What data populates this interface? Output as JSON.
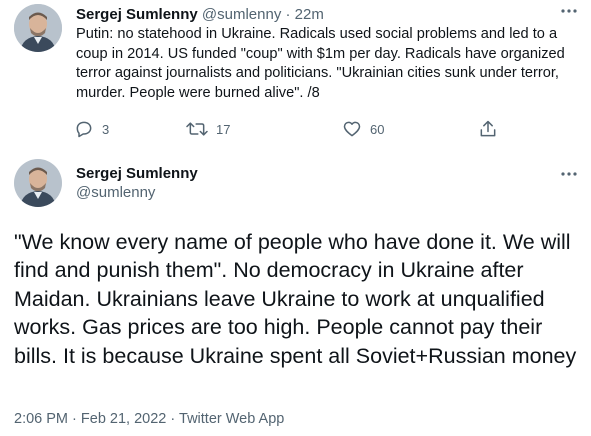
{
  "tweet1": {
    "author_name": "Sergej Sumlenny",
    "author_handle": "@sumlenny",
    "separator": "·",
    "time": "22m",
    "text": "Putin: no statehood in Ukraine. Radicals used social problems and led to a coup in 2014. US funded \"coup\" with $1m per day. Radicals have organized terror against journalists and politicians. \"Ukrainian cities sunk under terror, murder. People were burned alive\". /8",
    "replies": "3",
    "retweets": "17",
    "likes": "60",
    "icons": {
      "reply": "reply-icon",
      "retweet": "retweet-icon",
      "like": "heart-icon",
      "share": "share-icon",
      "more": "more-icon"
    }
  },
  "tweet2": {
    "author_name": "Sergej Sumlenny",
    "author_handle": "@sumlenny",
    "text": "\"We know every name of people who have done it. We will find and punish them\". No democracy in Ukraine after Maidan. Ukrainians leave Ukraine to work at unqualified works. Gas prices are too high. People cannot pay their bills. It is because Ukraine spent all Soviet+Russian money",
    "time": "2:06 PM",
    "date": "Feb 21, 2022",
    "meta_separator": "·",
    "source": "Twitter Web App"
  },
  "colors": {
    "text": "#0f1419",
    "secondary": "#536471",
    "background": "#ffffff"
  }
}
